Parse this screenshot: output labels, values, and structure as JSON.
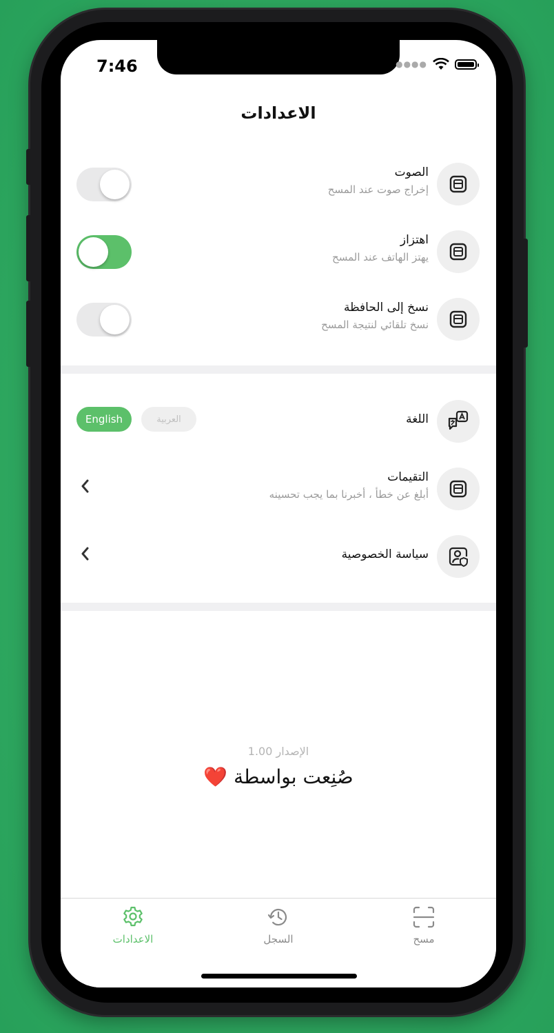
{
  "colors": {
    "accent": "#5cc06a",
    "background_outer": "#2fa860"
  },
  "status_bar": {
    "time": "7:46",
    "icons": [
      "signal-dots-icon",
      "wifi-icon",
      "battery-icon"
    ]
  },
  "header": {
    "title": "الاعدادات"
  },
  "settings": {
    "sound": {
      "title": "الصوت",
      "subtitle": "إخراج صوت عند المسح",
      "enabled": false,
      "icon": "box-icon"
    },
    "vibration": {
      "title": "اهتزاز",
      "subtitle": "يهتز الهاتف عند المسح",
      "enabled": true,
      "icon": "box-icon"
    },
    "clipboard": {
      "title": "نسخ إلى الحافظة",
      "subtitle": "نسخ تلقائي لنتيجة المسح",
      "enabled": false,
      "icon": "box-icon"
    }
  },
  "language": {
    "title": "اللغة",
    "options": [
      "العربية",
      "English"
    ],
    "selected": "English",
    "icon": "translate-icon"
  },
  "ratings": {
    "title": "التقيمات",
    "subtitle": "أبلغ عن خطأ ، أخبرنا بما يجب تحسينه",
    "icon": "box-icon"
  },
  "privacy": {
    "title": "سياسة الخصوصية",
    "icon": "privacy-user-shield-icon"
  },
  "footer": {
    "version": "الإصدار 1.00",
    "made_by": "صُنِعت بواسطة ❤️"
  },
  "tabbar": {
    "items": [
      {
        "label": "الاعدادات",
        "icon": "gear-icon",
        "active": true
      },
      {
        "label": "السجل",
        "icon": "history-icon",
        "active": false
      },
      {
        "label": "مسح",
        "icon": "scan-icon",
        "active": false
      }
    ]
  }
}
